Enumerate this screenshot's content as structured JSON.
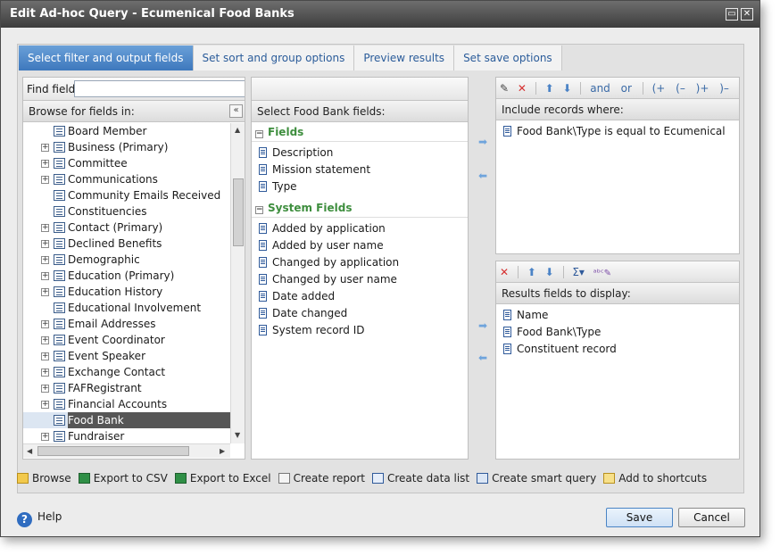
{
  "window": {
    "title": "Edit Ad-hoc Query - Ecumenical Food Banks"
  },
  "tabs": [
    {
      "label": "Select filter and output fields",
      "active": true
    },
    {
      "label": "Set sort and group options",
      "active": false
    },
    {
      "label": "Preview results",
      "active": false
    },
    {
      "label": "Set save options",
      "active": false
    }
  ],
  "browse": {
    "find_label": "Find field:",
    "find_value": "",
    "header": "Browse for fields in:",
    "items": [
      {
        "label": "Board Member",
        "expandable": false
      },
      {
        "label": "Business (Primary)",
        "expandable": true
      },
      {
        "label": "Committee",
        "expandable": true
      },
      {
        "label": "Communications",
        "expandable": true
      },
      {
        "label": "Community Emails Received",
        "expandable": false
      },
      {
        "label": "Constituencies",
        "expandable": false
      },
      {
        "label": "Contact (Primary)",
        "expandable": true
      },
      {
        "label": "Declined Benefits",
        "expandable": true
      },
      {
        "label": "Demographic",
        "expandable": true
      },
      {
        "label": "Education (Primary)",
        "expandable": true
      },
      {
        "label": "Education History",
        "expandable": true
      },
      {
        "label": "Educational Involvement",
        "expandable": false
      },
      {
        "label": "Email Addresses",
        "expandable": true
      },
      {
        "label": "Event Coordinator",
        "expandable": true
      },
      {
        "label": "Event Speaker",
        "expandable": true
      },
      {
        "label": "Exchange Contact",
        "expandable": true
      },
      {
        "label": "FAFRegistrant",
        "expandable": true
      },
      {
        "label": "Financial Accounts",
        "expandable": true
      },
      {
        "label": "Food Bank",
        "expandable": false,
        "selected": true
      },
      {
        "label": "Fundraiser",
        "expandable": true
      }
    ]
  },
  "select_fields": {
    "header": "Select Food Bank fields:",
    "groups": [
      {
        "label": "Fields",
        "items": [
          "Description",
          "Mission statement",
          "Type"
        ]
      },
      {
        "label": "System Fields",
        "items": [
          "Added by application",
          "Added by user name",
          "Changed by application",
          "Changed by user name",
          "Date added",
          "Date changed",
          "System record ID"
        ]
      }
    ]
  },
  "filters": {
    "toolbar": {
      "and_label": "and",
      "or_label": "or",
      "open_paren": "(+",
      "open_paren_minus": "(–",
      "close_paren": ")+",
      "close_paren_minus": ")–"
    },
    "header": "Include records where:",
    "items": [
      "Food Bank\\Type is equal to Ecumenical"
    ]
  },
  "results": {
    "header": "Results fields to display:",
    "items": [
      "Name",
      "Food Bank\\Type",
      "Constituent record"
    ]
  },
  "bottom_actions": [
    {
      "label": "Browse",
      "icon": "folder-icon"
    },
    {
      "label": "Export to CSV",
      "icon": "excel-icon"
    },
    {
      "label": "Export to Excel",
      "icon": "excel-icon"
    },
    {
      "label": "Create report",
      "icon": "report-icon"
    },
    {
      "label": "Create data list",
      "icon": "list-icon"
    },
    {
      "label": "Create smart query",
      "icon": "smart-query-icon"
    },
    {
      "label": "Add to shortcuts",
      "icon": "shortcut-icon"
    }
  ],
  "footer": {
    "help_label": "Help",
    "save_label": "Save",
    "cancel_label": "Cancel"
  }
}
